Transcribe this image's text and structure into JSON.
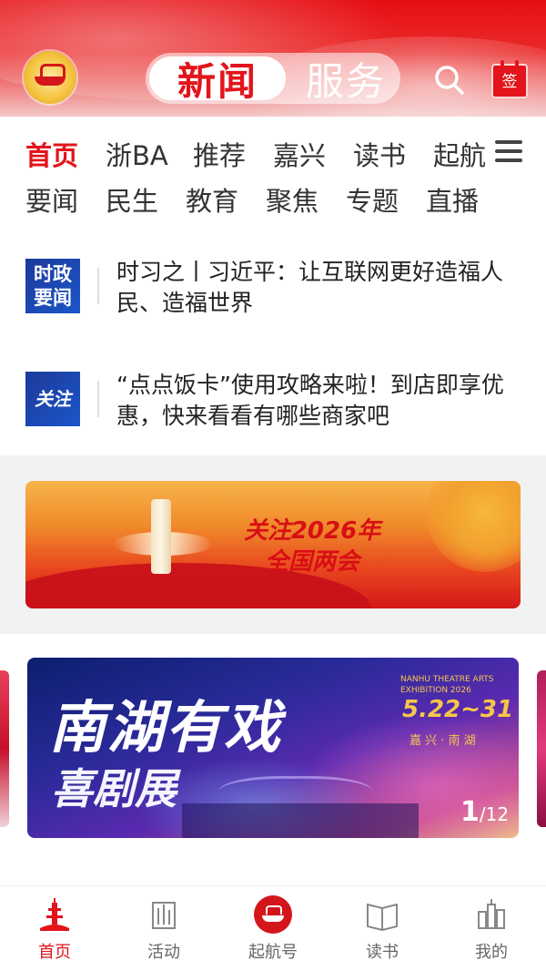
{
  "header": {
    "tabs": [
      {
        "label": "新闻",
        "active": true
      },
      {
        "label": "服务",
        "active": false
      }
    ],
    "search_icon": "search-icon",
    "sign_icon": "calendar-sign-icon",
    "sign_label": "签",
    "accent_color": "#e3141b"
  },
  "channels": {
    "row1": [
      {
        "label": "首页",
        "active": true
      },
      {
        "label": "浙BA",
        "active": false
      },
      {
        "label": "推荐",
        "active": false
      },
      {
        "label": "嘉兴",
        "active": false
      },
      {
        "label": "读书",
        "active": false
      },
      {
        "label": "起航",
        "active": false
      }
    ],
    "row2": [
      {
        "label": "要闻"
      },
      {
        "label": "民生"
      },
      {
        "label": "教育"
      },
      {
        "label": "聚焦"
      },
      {
        "label": "专题"
      },
      {
        "label": "直播"
      }
    ],
    "menu_icon": "hamburger-menu-icon"
  },
  "news": [
    {
      "badge": "时政\n要闻",
      "badge_line1": "时政",
      "badge_line2": "要闻",
      "title": "时习之丨习近平：让互联网更好造福人民、造福世界"
    },
    {
      "badge_text": "关注",
      "title": "“点点饭卡”使用攻略来啦！到店即享优惠，快来看看有哪些商家吧"
    }
  ],
  "banner": {
    "line1": "关注2026年",
    "line2": "全国两会"
  },
  "carousel": {
    "title": "南湖有戏",
    "subtitle": "喜剧展",
    "english": "NANHU THEATRE ARTS EXHIBITION 2026",
    "dates": "5.22~31",
    "place": "嘉 兴 · 南 湖",
    "current": "1",
    "total": "/12"
  },
  "bottom_nav": [
    {
      "label": "首页",
      "icon": "home-tower-icon",
      "active": true
    },
    {
      "label": "活动",
      "icon": "activity-icon",
      "active": false
    },
    {
      "label": "起航号",
      "icon": "red-boat-icon",
      "active": false
    },
    {
      "label": "读书",
      "icon": "open-book-icon",
      "active": false
    },
    {
      "label": "我的",
      "icon": "profile-building-icon",
      "active": false
    }
  ]
}
